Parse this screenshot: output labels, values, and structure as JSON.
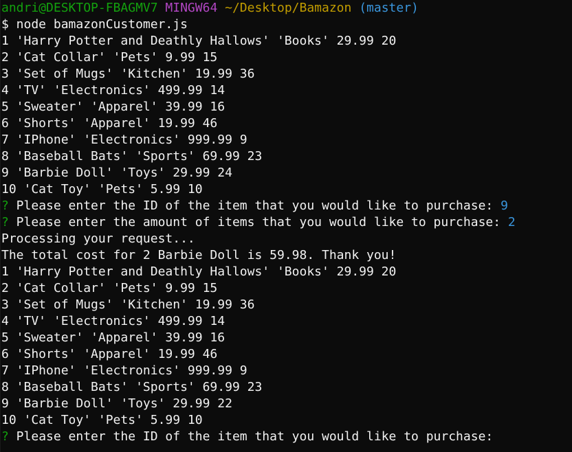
{
  "prompt_header": {
    "user_host": "andri@DESKTOP-FBAGMV7",
    "env": "MINGW64",
    "path": "~/Desktop/Bamazon",
    "branch": "(master)"
  },
  "command": "$ node bamazonCustomer.js",
  "table1": [
    "1 'Harry Potter and Deathly Hallows' 'Books' 29.99 20",
    "2 'Cat Collar' 'Pets' 9.99 15",
    "3 'Set of Mugs' 'Kitchen' 19.99 36",
    "4 'TV' 'Electronics' 499.99 14",
    "5 'Sweater' 'Apparel' 39.99 16",
    "6 'Shorts' 'Apparel' 19.99 46",
    "7 'IPhone' 'Electronics' 999.99 9",
    "8 'Baseball Bats' 'Sports' 69.99 23",
    "9 'Barbie Doll' 'Toys' 29.99 24",
    "10 'Cat Toy' 'Pets' 5.99 10"
  ],
  "question1": {
    "mark": "?",
    "text": " Please enter the ID of the item that you would like to purchase: ",
    "answer": "9"
  },
  "question2": {
    "mark": "?",
    "text": " Please enter the amount of items that you would like to purchase: ",
    "answer": "2"
  },
  "processing": "Processing your request...",
  "total": "The total cost for 2 Barbie Doll is 59.98. Thank you!",
  "table2": [
    "1 'Harry Potter and Deathly Hallows' 'Books' 29.99 20",
    "2 'Cat Collar' 'Pets' 9.99 15",
    "3 'Set of Mugs' 'Kitchen' 19.99 36",
    "4 'TV' 'Electronics' 499.99 14",
    "5 'Sweater' 'Apparel' 39.99 16",
    "6 'Shorts' 'Apparel' 19.99 46",
    "7 'IPhone' 'Electronics' 999.99 9",
    "8 'Baseball Bats' 'Sports' 69.99 23",
    "9 'Barbie Doll' 'Toys' 29.99 22",
    "10 'Cat Toy' 'Pets' 5.99 10"
  ],
  "question3": {
    "mark": "?",
    "text": " Please enter the ID of the item that you would like to purchase:"
  },
  "colors": {
    "background": "#0c0c0c",
    "foreground": "#f2f2f2",
    "user_host": "#13a10e",
    "env": "#b146c2",
    "path": "#c19c00",
    "branch": "#3a96dd",
    "prompt_mark": "#13a10e",
    "answer": "#3a96dd"
  }
}
